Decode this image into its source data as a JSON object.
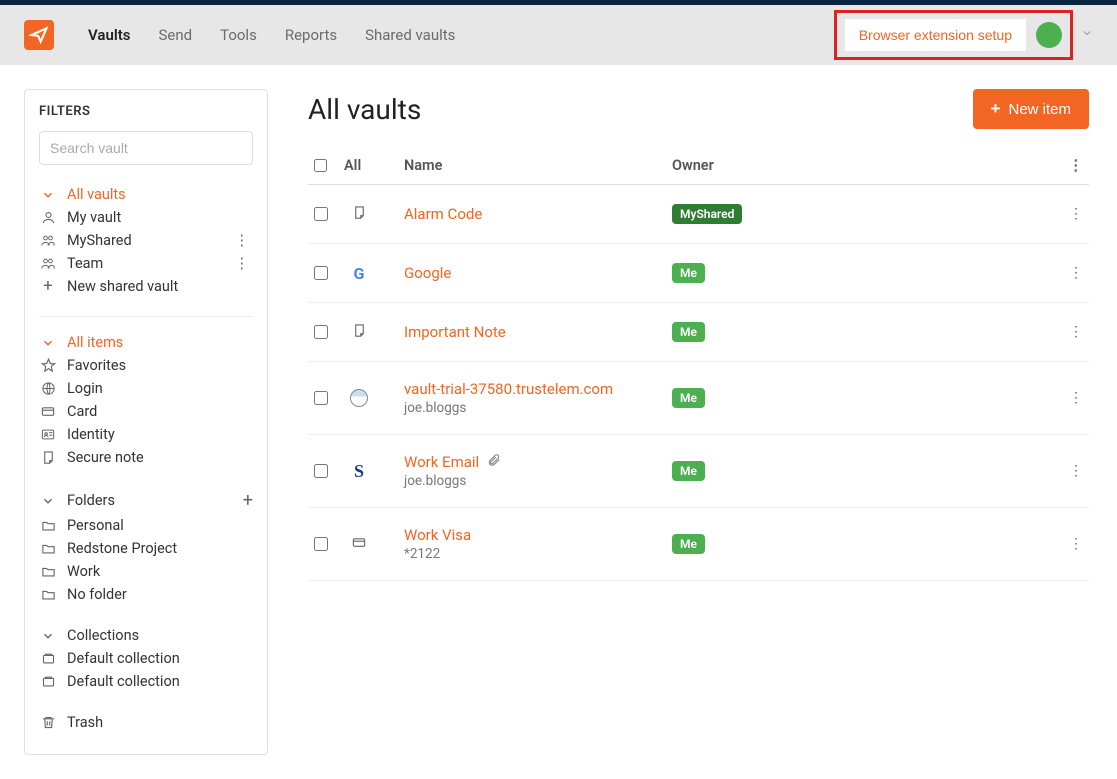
{
  "header": {
    "nav": [
      "Vaults",
      "Send",
      "Tools",
      "Reports",
      "Shared vaults"
    ],
    "active_nav_idx": 0,
    "browser_ext_label": "Browser extension setup"
  },
  "sidebar": {
    "title": "FILTERS",
    "search_placeholder": "Search vault",
    "vaults_header": "All vaults",
    "vaults": [
      {
        "label": "My vault",
        "icon": "user"
      },
      {
        "label": "MyShared",
        "icon": "group",
        "has_menu": true
      },
      {
        "label": "Team",
        "icon": "group",
        "has_menu": true
      },
      {
        "label": "New shared vault",
        "icon": "plus"
      }
    ],
    "items_header": "All items",
    "item_types": [
      {
        "label": "Favorites",
        "icon": "star"
      },
      {
        "label": "Login",
        "icon": "globe"
      },
      {
        "label": "Card",
        "icon": "card"
      },
      {
        "label": "Identity",
        "icon": "id"
      },
      {
        "label": "Secure note",
        "icon": "note"
      }
    ],
    "folders_header": "Folders",
    "folders": [
      {
        "label": "Personal"
      },
      {
        "label": "Redstone Project"
      },
      {
        "label": "Work"
      },
      {
        "label": "No folder"
      }
    ],
    "collections_header": "Collections",
    "collections": [
      {
        "label": "Default collection"
      },
      {
        "label": "Default collection"
      }
    ],
    "trash_label": "Trash"
  },
  "main": {
    "title": "All vaults",
    "new_item_label": "New item",
    "table": {
      "all_label": "All",
      "name_label": "Name",
      "owner_label": "Owner"
    },
    "rows": [
      {
        "title": "Alarm Code",
        "sub": "",
        "icon": "note",
        "owner": "MyShared",
        "owner_style": "greensolid"
      },
      {
        "title": "Google",
        "sub": "",
        "icon": "google",
        "owner": "Me",
        "owner_style": "green"
      },
      {
        "title": "Important Note",
        "sub": "",
        "icon": "note",
        "owner": "Me",
        "owner_style": "green"
      },
      {
        "title": "vault-trial-37580.trustelem.com",
        "sub": "joe.bloggs",
        "icon": "globe",
        "owner": "Me",
        "owner_style": "green"
      },
      {
        "title": "Work Email",
        "sub": "joe.bloggs",
        "icon": "s",
        "owner": "Me",
        "owner_style": "green",
        "has_attach": true
      },
      {
        "title": "Work Visa",
        "sub": "*2122",
        "icon": "card",
        "owner": "Me",
        "owner_style": "green"
      }
    ]
  }
}
